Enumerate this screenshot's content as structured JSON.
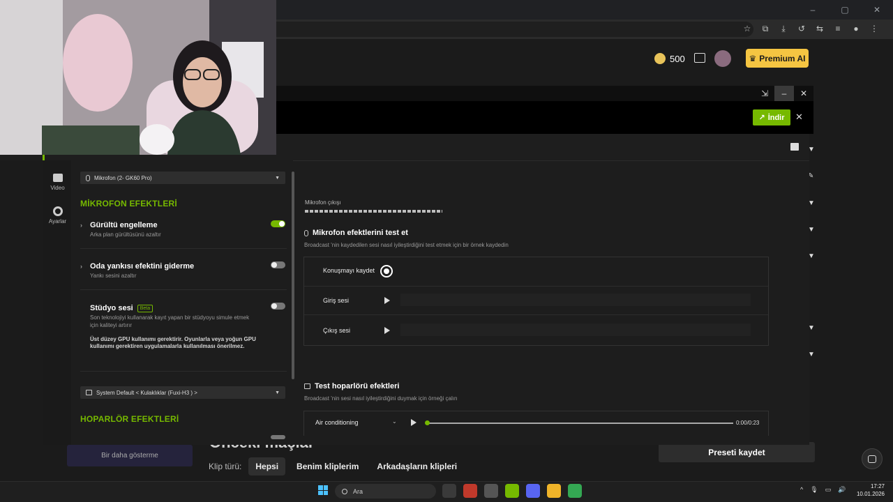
{
  "top_bar": {
    "coins": "500",
    "premium_label": "Premium AI"
  },
  "overlay": {
    "download_label": "İndir",
    "nav": [
      {
        "label": "Video",
        "icon": "video-icon"
      },
      {
        "label": "Ayarlar",
        "icon": "gear-icon"
      }
    ],
    "mic_select": "Mikrofon (2- GK60 Pro)",
    "mic_effects_title": "MİKROFON EFEKTLERİ",
    "effects": [
      {
        "name": "Gürültü engelleme",
        "desc": "Arka plan gürültüsünü azaltır",
        "enabled": true
      },
      {
        "name": "Oda yankısı efektini giderme",
        "desc": "Yankı sesini azaltır",
        "enabled": false
      },
      {
        "name": "Stüdyo sesi",
        "badge": "Beta",
        "desc": "Son teknolojiyi kullanarak kayıt yapan bir stüdyoyu simule etmek için kaliteyi artırır",
        "warning": "Üst düzey GPU kullanımı gerektirir. Oyunlarla veya yoğun GPU kullanımı gerektiren uygulamalarla kullanılması önerilmez.",
        "enabled": false
      }
    ],
    "speaker_select": "System Default < Kulaklıklar (Fuxi-H3 ) >",
    "speaker_effects_title": "HOPARLÖR EFEKTLERİ",
    "mic_output_label": "Mikrofon çıkışı",
    "test_mic_title": "Mikrofon efektlerini test et",
    "test_mic_desc": "Broadcast 'nin kaydedilen sesi nasıl iyileştirdiğini test etmek için bir örnek kaydedin",
    "test_rows": [
      "Konuşmayı kaydet",
      "Giriş sesi",
      "Çıkış sesi"
    ],
    "test_speaker_title": "Test hoparlörü efektleri",
    "test_speaker_desc": "Broadcast 'nin sesi nasıl iyileştirdiğini duymak için örneği çalın",
    "sample_select": "Air conditioning",
    "sample_time": "0:00/0:23",
    "sample_progress": 0
  },
  "page": {
    "older_heading": "Önceki maçlar",
    "show_less": "Bir daha gösterme",
    "clip_type_label": "Klip türü:",
    "clip_types": [
      "Hepsi",
      "Benim kliplerim",
      "Arkadaşların klipleri"
    ],
    "save_preset": "Preseti kaydet"
  },
  "taskbar": {
    "search_placeholder": "Ara",
    "time": "17:27",
    "date": "10.01.2026"
  },
  "colors": {
    "accent": "#76b900",
    "premium": "#f5c542",
    "panel": "#1d1d1d"
  }
}
